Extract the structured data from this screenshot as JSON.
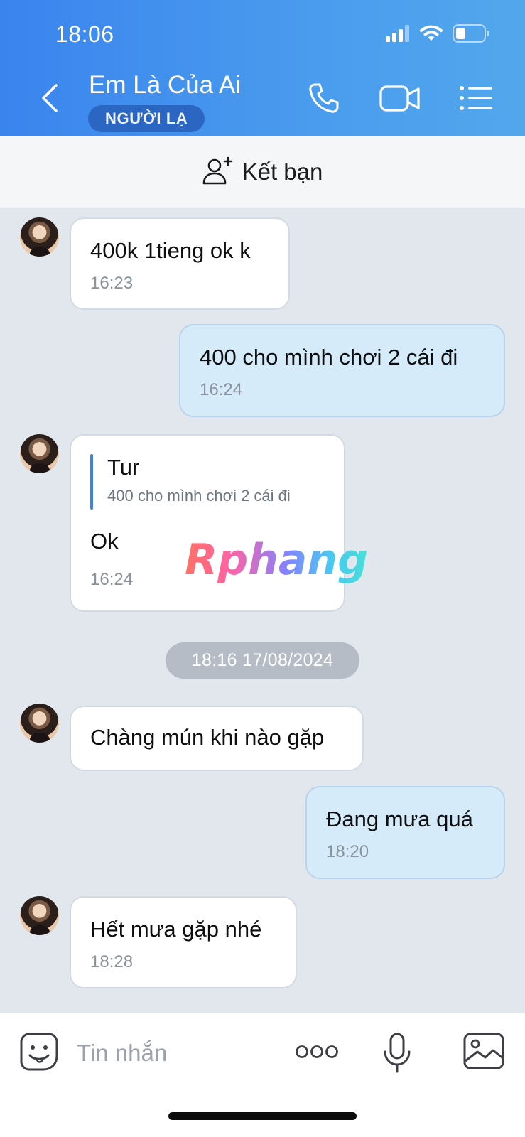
{
  "status_bar": {
    "time": "18:06"
  },
  "header": {
    "contact_name": "Em Là Của Ai",
    "badge": "NGƯỜI LẠ",
    "icons": {
      "back": "chevron-left-icon",
      "call": "phone-icon",
      "video": "video-camera-icon",
      "menu": "list-menu-icon"
    }
  },
  "add_friend": {
    "label": "Kết bạn",
    "icon": "add-person-icon"
  },
  "messages": [
    {
      "direction": "in",
      "text": "400k 1tieng ok k",
      "time": "16:23"
    },
    {
      "direction": "out",
      "text": "400 cho mình chơi 2 cái đi",
      "time": "16:24"
    },
    {
      "direction": "in",
      "quote_author": "Tur",
      "quote_text": "400 cho mình chơi 2 cái đi",
      "text": "Ok",
      "time": "16:24"
    },
    {
      "direction": "in",
      "text": "Chàng mún khi nào gặp",
      "time": ""
    },
    {
      "direction": "out",
      "text": "Đang mưa quá",
      "time": "18:20"
    },
    {
      "direction": "in",
      "text": "Hết mưa gặp nhé",
      "time": "18:28"
    }
  ],
  "date_separator": "18:16 17/08/2024",
  "watermark": "Rphang",
  "composer": {
    "placeholder": "Tin nhắn",
    "icons": {
      "sticker": "sticker-smile-icon",
      "more": "more-dots-icon",
      "mic": "microphone-icon",
      "image": "image-icon"
    }
  },
  "colors": {
    "header_start": "#3a84ee",
    "header_end": "#52a7ec",
    "badge_bg": "#2b66c3",
    "chat_bg": "#e2e7ee",
    "incoming_bubble": "#ffffff",
    "outgoing_bubble": "#d6ebfa",
    "quote_accent": "#3b82ee"
  }
}
